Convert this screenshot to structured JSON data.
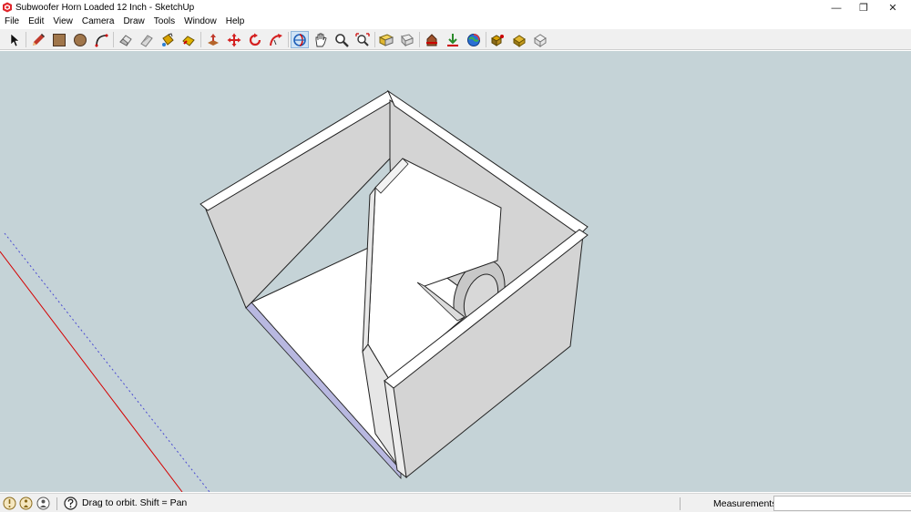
{
  "window": {
    "title": "Subwoofer Horn Loaded 12 Inch - SketchUp",
    "minimize_glyph": "—",
    "maximize_glyph": "❐",
    "close_glyph": "✕"
  },
  "menu": {
    "items": [
      "File",
      "Edit",
      "View",
      "Camera",
      "Draw",
      "Tools",
      "Window",
      "Help"
    ]
  },
  "toolbar": {
    "icons": [
      "select-icon",
      "pencil-icon",
      "rectangle-icon",
      "circle-icon",
      "arc-icon",
      "eraser-icon",
      "tape-measure-icon",
      "paint-bucket-icon",
      "eraser-sponge-icon",
      "push-pull-icon",
      "move-icon",
      "rotate-icon",
      "follow-me-icon",
      "orbit-icon",
      "pan-icon",
      "zoom-icon",
      "zoom-extents-icon",
      "views-icon",
      "section-icon",
      "warehouse-icon",
      "extension-icon",
      "geolocation-icon",
      "components-icon",
      "materials-icon",
      "styles-icon"
    ]
  },
  "colors": {
    "viewport_bg": "#c5d3d7",
    "wall_face": "#d4d4d4",
    "wall_top": "#ffffff",
    "red_axis": "#d40000",
    "blue_axis": "#4b4bd2",
    "base_edge": "#b8b8e0"
  },
  "status": {
    "hint": "Drag to orbit.  Shift = Pan",
    "measurements_label": "Measurements",
    "measurements_value": ""
  }
}
